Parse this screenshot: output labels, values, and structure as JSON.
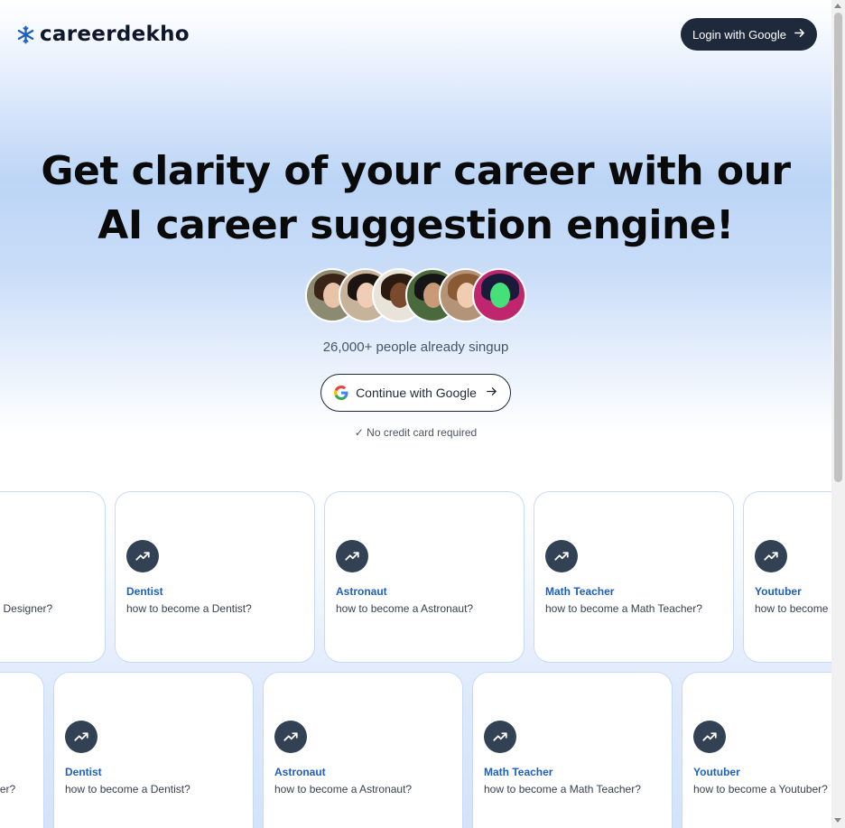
{
  "header": {
    "logo_text": "careerdekho",
    "login_label": "Login with Google",
    "brand_color": "#1d5fbf"
  },
  "hero": {
    "headline_line1": "Get clarity of your career with our",
    "headline_line2": "AI career suggestion engine!",
    "signup_count": "26,000+ people already singup",
    "cta_label": "Continue with Google",
    "no_card_note": "✓ No credit card required"
  },
  "avatars": [
    {
      "icon": "avatar-woman-1"
    },
    {
      "icon": "avatar-woman-2"
    },
    {
      "icon": "avatar-woman-3"
    },
    {
      "icon": "avatar-man-1"
    },
    {
      "icon": "avatar-woman-4"
    },
    {
      "icon": "avatar-neon"
    }
  ],
  "cards_row1": [
    {
      "title": "",
      "subtitle": "how to become a Web Designer?"
    },
    {
      "title": "Dentist",
      "subtitle": "how to become a Dentist?"
    },
    {
      "title": "Astronaut",
      "subtitle": "how to become a Astronaut?"
    },
    {
      "title": "Math Teacher",
      "subtitle": "how to become a Math Teacher?"
    },
    {
      "title": "Youtuber",
      "subtitle": "how to become a Youtuber?"
    }
  ],
  "cards_row2": [
    {
      "title": "",
      "subtitle": "how to become a Web Designer?"
    },
    {
      "title": "Dentist",
      "subtitle": "how to become a Dentist?"
    },
    {
      "title": "Astronaut",
      "subtitle": "how to become a Astronaut?"
    },
    {
      "title": "Math Teacher",
      "subtitle": "how to become a Math Teacher?"
    },
    {
      "title": "Youtuber",
      "subtitle": "how to become a Youtuber?"
    }
  ]
}
